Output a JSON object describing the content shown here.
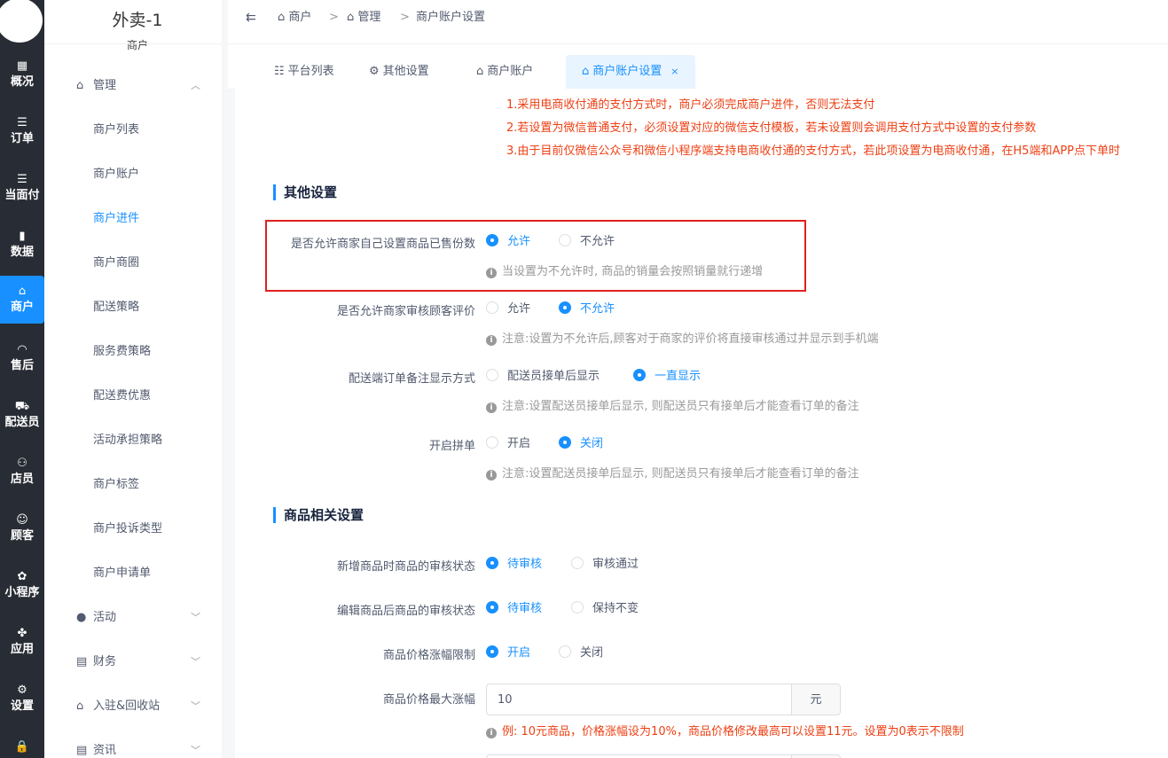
{
  "rail": {
    "items": [
      {
        "label": "概况",
        "icon": "grid-icon",
        "glyph": "▦"
      },
      {
        "label": "订单",
        "icon": "list-icon",
        "glyph": "☰"
      },
      {
        "label": "当面付",
        "icon": "list-icon",
        "glyph": "☰"
      },
      {
        "label": "数据",
        "icon": "bar-chart-icon",
        "glyph": "▮"
      },
      {
        "label": "商户",
        "icon": "store-icon",
        "glyph": "⌂"
      },
      {
        "label": "售后",
        "icon": "headset-icon",
        "glyph": "◠"
      },
      {
        "label": "配送员",
        "icon": "truck-icon",
        "glyph": "⛟"
      },
      {
        "label": "店员",
        "icon": "users-icon",
        "glyph": "⚇"
      },
      {
        "label": "顾客",
        "icon": "user-circle-icon",
        "glyph": "☺"
      },
      {
        "label": "小程序",
        "icon": "wechat-icon",
        "glyph": "✿"
      },
      {
        "label": "应用",
        "icon": "apps-icon",
        "glyph": "✤"
      },
      {
        "label": "设置",
        "icon": "user-gear-icon",
        "glyph": "⚙"
      },
      {
        "label": "",
        "icon": "lock-icon",
        "glyph": "🔒"
      }
    ]
  },
  "menu": {
    "app_title": "外卖-1",
    "app_sub": "商户",
    "groups": [
      {
        "label": "管理",
        "glyph": "⌂",
        "arrow": "︿"
      },
      {
        "label": "活动",
        "glyph": "●",
        "arrow": "﹀"
      },
      {
        "label": "财务",
        "glyph": "▤",
        "arrow": "﹀"
      },
      {
        "label": "入驻&回收站",
        "glyph": "⌂",
        "arrow": "﹀"
      },
      {
        "label": "资讯",
        "glyph": "▤",
        "arrow": "﹀"
      }
    ],
    "items": [
      "商户列表",
      "商户账户",
      "商户进件",
      "商户商圈",
      "配送策略",
      "服务费策略",
      "配送费优惠",
      "活动承担策略",
      "商户标签",
      "商户投诉类型",
      "商户申请单"
    ]
  },
  "breadcrumb": {
    "collapse": "⇇",
    "c1": "商户",
    "c2": "管理",
    "c3": "商户账户设置",
    "sep": ">"
  },
  "tabs": [
    {
      "label": "平台列表",
      "glyph": "☷"
    },
    {
      "label": "其他设置",
      "glyph": "⚙"
    },
    {
      "label": "商户账户",
      "glyph": "⌂"
    },
    {
      "label": "商户账户设置",
      "glyph": "⌂",
      "close": "×"
    }
  ],
  "notices": [
    "1.采用电商收付通的支付方式时，商户必须完成商户进件，否则无法支付",
    "2.若设置为微信普通支付，必须设置对应的微信支付模板，若未设置则会调用支付方式中设置的支付参数",
    "3.由于目前仅微信公众号和微信小程序端支持电商收付通的支付方式，若此项设置为电商收付通，在H5端和APP点下单时"
  ],
  "other_settings": {
    "title": "其他设置",
    "rows": [
      {
        "label": "是否允许商家自己设置商品已售份数",
        "options": [
          "允许",
          "不允许"
        ],
        "selected": 0,
        "help": "当设置为不允许时, 商品的销量会按照销量就行递增"
      },
      {
        "label": "是否允许商家审核顾客评价",
        "options": [
          "允许",
          "不允许"
        ],
        "selected": 1,
        "help": "注意:设置为不允许后,顾客对于商家的评价将直接审核通过并显示到手机端"
      },
      {
        "label": "配送端订单备注显示方式",
        "options": [
          "配送员接单后显示",
          "一直显示"
        ],
        "selected": 1,
        "help": "注意:设置配送员接单后显示, 则配送员只有接单后才能查看订单的备注"
      },
      {
        "label": "开启拼单",
        "options": [
          "开启",
          "关闭"
        ],
        "selected": 1,
        "help": "注意:设置配送员接单后显示, 则配送员只有接单后才能查看订单的备注"
      }
    ]
  },
  "goods_settings": {
    "title": "商品相关设置",
    "rows": [
      {
        "label": "新增商品时商品的审核状态",
        "options": [
          "待审核",
          "审核通过"
        ],
        "selected": 0
      },
      {
        "label": "编辑商品后商品的审核状态",
        "options": [
          "待审核",
          "保持不变"
        ],
        "selected": 0
      },
      {
        "label": "商品价格涨幅限制",
        "options": [
          "开启",
          "关闭"
        ],
        "selected": 0
      }
    ],
    "max_rise": {
      "label": "商品价格最大涨幅",
      "value": "10",
      "unit": "元",
      "help": "例: 10元商品，价格涨幅设为10%，商品价格修改最高可以设置11元。设置为0表示不限制"
    }
  },
  "colors": {
    "primary": "#1890ff",
    "danger": "#ed4014",
    "rail_bg": "#282c34",
    "highlight_border": "#e02020"
  }
}
